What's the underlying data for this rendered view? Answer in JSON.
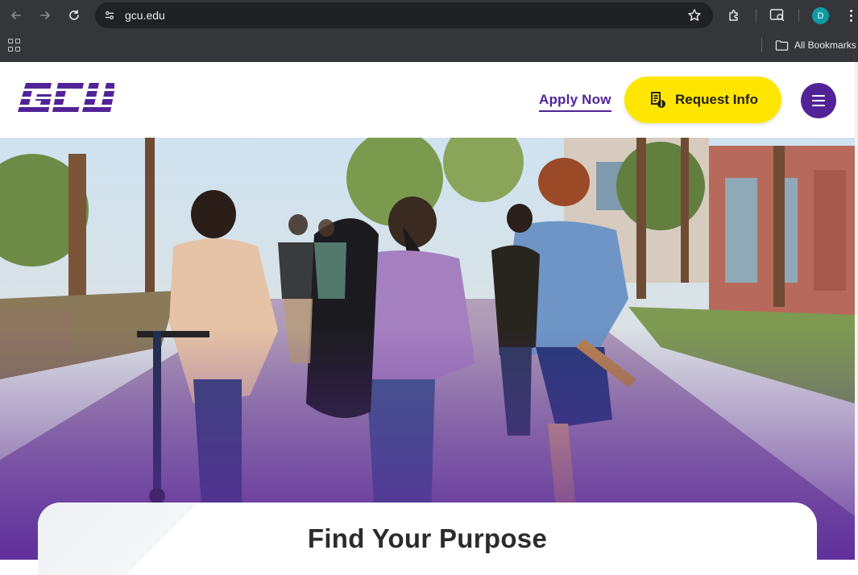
{
  "browser": {
    "url": "gcu.edu",
    "profile_initial": "D",
    "bookmarks_label": "All Bookmarks",
    "icons": [
      "back-icon",
      "forward-icon",
      "reload-icon",
      "site-info-icon",
      "star-icon",
      "extensions-icon",
      "tab-search-icon",
      "apps-icon",
      "folder-icon",
      "kebab-menu-icon"
    ]
  },
  "header": {
    "logo_text": "GCU",
    "apply_label": "Apply Now",
    "request_label": "Request Info",
    "menu_icon": "hamburger-icon"
  },
  "hero": {
    "card_title": "Find Your Purpose"
  },
  "colors": {
    "brand_purple": "#522398",
    "cta_yellow": "#ffe600",
    "chrome_dark": "#35363a"
  }
}
